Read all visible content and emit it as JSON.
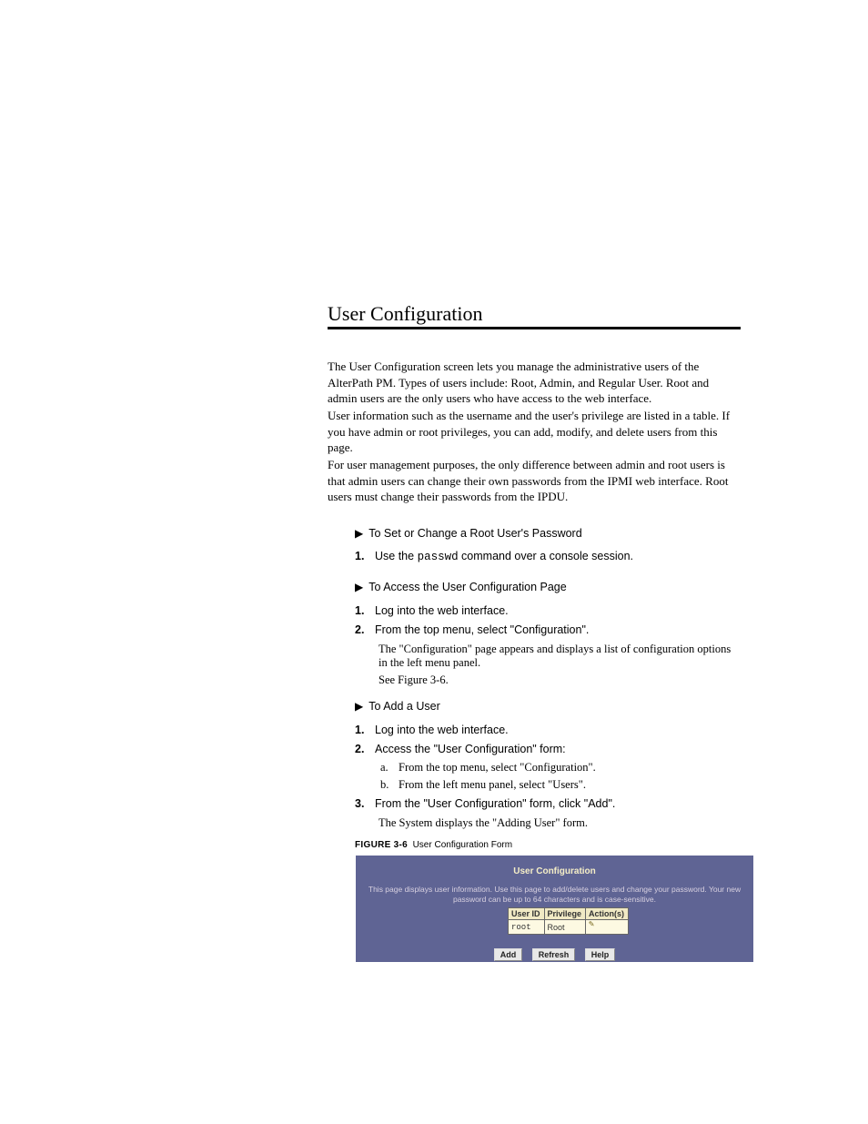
{
  "section": {
    "title": "User Configuration",
    "para1": "The User Configuration screen lets you manage the administrative users of the AlterPath PM. Types of users include: Root, Admin, and Regular User. Root and admin users are the only users who have access to the web interface.",
    "para2": "User information such as the username and the user's privilege are listed in a table. If you have admin or root privileges, you can add, modify, and delete users from this page.",
    "para3": "For user management purposes, the only difference between admin and root users is that admin users can change their own passwords from the IPMI web interface. Root users must change their passwords from the IPDU."
  },
  "procs": {
    "p1": {
      "title": "To Set or Change a Root User's Password",
      "step1": "Use the passwd command over a console session."
    },
    "p2": {
      "title": "To Access the User Configuration Page",
      "step1": "Log into the web interface.",
      "step2": "From the top menu, select \"Configuration\".",
      "sub1": "The \"Configuration\" page appears and displays a list of configuration options in the left menu panel.",
      "sub2": "See Figure 3-6."
    },
    "p3": {
      "title": "To Add a User",
      "step1": "Log into the web interface.",
      "step2": "Access the \"User Configuration\" form:",
      "sub1": "From the top menu, select \"Configuration\".",
      "sub2": "From the left menu panel, select \"Users\".",
      "step3": "From the \"User Configuration\" form, click \"Add\".",
      "sub3": "The System displays the \"Adding User\" form."
    }
  },
  "figure": {
    "label": "FIGURE 3-6",
    "caption": "User Configuration Form"
  },
  "screenshot": {
    "title": "User Configuration",
    "description": "This page displays user information. Use this page to add/delete users and change your password. Your new password can be up to 64 characters and is case-sensitive.",
    "headers": {
      "c1": "User ID",
      "c2": "Privilege",
      "c3": "Action(s)"
    },
    "row": {
      "c1": "root",
      "c2": "Root"
    },
    "buttons": {
      "add": "Add",
      "refresh": "Refresh",
      "help": "Help"
    }
  }
}
